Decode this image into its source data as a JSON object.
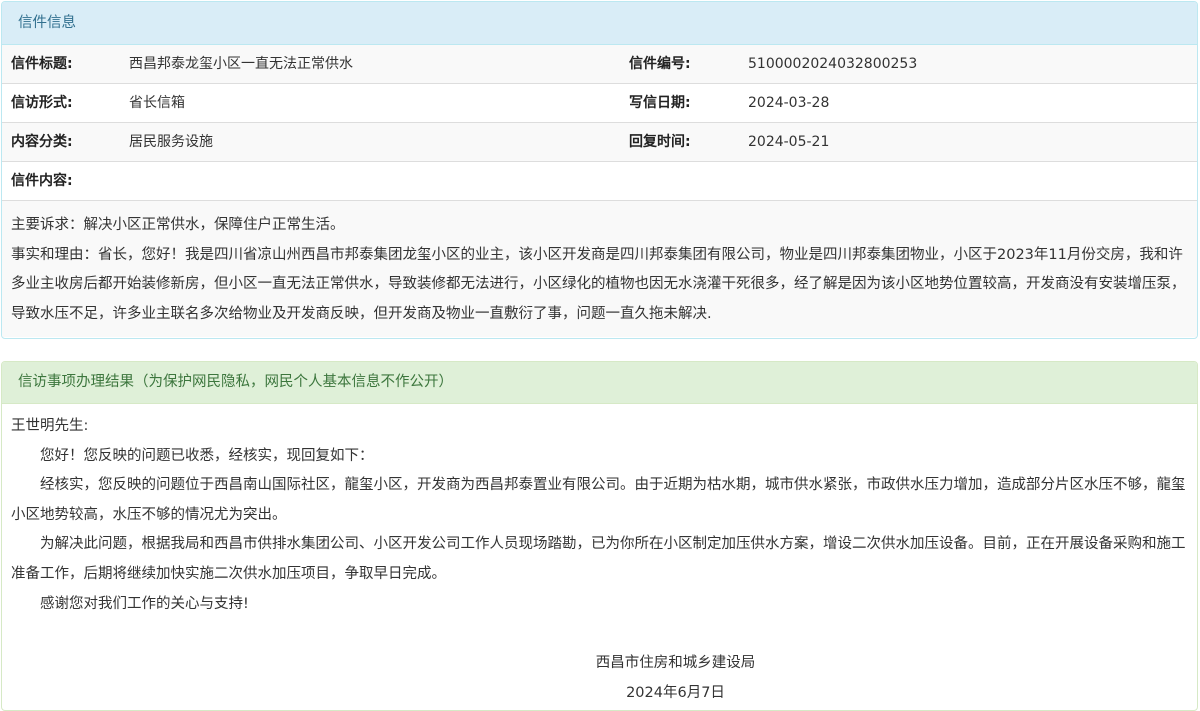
{
  "letter_info": {
    "heading": "信件信息",
    "rows": [
      {
        "label1": "信件标题:",
        "value1": "西昌邦泰龙玺小区一直无法正常供水",
        "label2": "信件编号:",
        "value2": "5100002024032800253"
      },
      {
        "label1": "信访形式:",
        "value1": "省长信箱",
        "label2": "写信日期:",
        "value2": "2024-03-28"
      },
      {
        "label1": "内容分类:",
        "value1": "居民服务设施",
        "label2": "回复时间:",
        "value2": "2024-05-21"
      }
    ],
    "content_label": "信件内容:",
    "content_lines": [
      "主要诉求：解决小区正常供水，保障住户正常生活。",
      "事实和理由：省长，您好！我是四川省凉山州西昌市邦泰集团龙玺小区的业主，该小区开发商是四川邦泰集团有限公司，物业是四川邦泰集团物业，小区于2023年11月份交房，我和许多业主收房后都开始装修新房，但小区一直无法正常供水，导致装修都无法进行，小区绿化的植物也因无水浇灌干死很多，经了解是因为该小区地势位置较高，开发商没有安装增压泵，导致水压不足，许多业主联名多次给物业及开发商反映，但开发商及物业一直敷衍了事，问题一直久拖未解决."
    ]
  },
  "result": {
    "heading": "信访事项办理结果（为保护网民隐私，网民个人基本信息不作公开）",
    "salutation": "王世明先生:",
    "greeting": "您好！您反映的问题已收悉，经核实，现回复如下：",
    "paragraph1": "经核实，您反映的问题位于西昌南山国际社区，龍玺小区，开发商为西昌邦泰置业有限公司。由于近期为枯水期，城市供水紧张，市政供水压力增加，造成部分片区水压不够，龍玺小区地势较高，水压不够的情况尤为突出。",
    "paragraph2": " 为解决此问题，根据我局和西昌市供排水集团公司、小区开发公司工作人员现场踏勘，已为你所在小区制定加压供水方案，增设二次供水加压设备。目前，正在开展设备采购和施工准备工作，后期将继续加快实施二次供水加压项目，争取早日完成。",
    "thanks": "感谢您对我们工作的关心与支持!",
    "signature": "西昌市住房和城乡建设局",
    "date": "2024年6月7日"
  },
  "colors": {
    "info_heading_bg": "#d9edf7",
    "info_heading_text": "#31708f",
    "success_heading_bg": "#dff0d8",
    "success_heading_text": "#3c763d"
  }
}
